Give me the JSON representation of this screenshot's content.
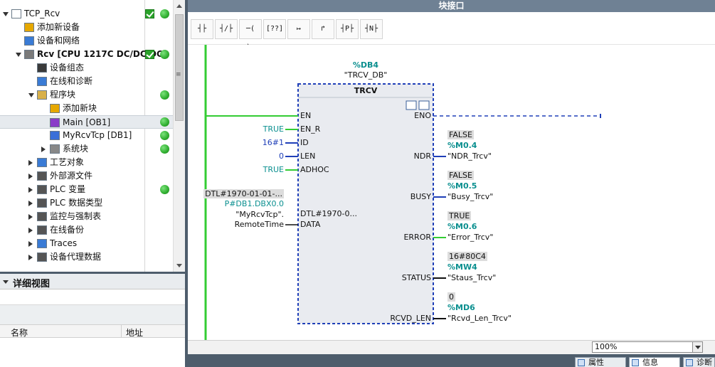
{
  "tree": {
    "items": [
      {
        "label": "TCP_Rcv",
        "indent": 0,
        "expand": "open",
        "icon": "project-icon",
        "check": true,
        "dot": true
      },
      {
        "label": "添加新设备",
        "indent": 1,
        "expand": "none",
        "icon": "add-device-icon"
      },
      {
        "label": "设备和网络",
        "indent": 1,
        "expand": "none",
        "icon": "network-icon"
      },
      {
        "label": "Rcv [CPU 1217C DC/DC/DC]",
        "indent": 1,
        "expand": "open",
        "icon": "cpu-icon",
        "check": true,
        "dot": true,
        "bold": true
      },
      {
        "label": "设备组态",
        "indent": 2,
        "expand": "none",
        "icon": "device-config-icon"
      },
      {
        "label": "在线和诊断",
        "indent": 2,
        "expand": "none",
        "icon": "diagnostics-icon"
      },
      {
        "label": "程序块",
        "indent": 2,
        "expand": "open",
        "icon": "folder-icon",
        "dot": true
      },
      {
        "label": "添加新块",
        "indent": 3,
        "expand": "none",
        "icon": "add-block-icon"
      },
      {
        "label": "Main [OB1]",
        "indent": 3,
        "expand": "none",
        "icon": "ob-block-icon",
        "dot": true,
        "selected": true
      },
      {
        "label": "MyRcvTcp [DB1]",
        "indent": 3,
        "expand": "none",
        "icon": "db-block-icon",
        "dot": true
      },
      {
        "label": "系统块",
        "indent": 3,
        "expand": "closed",
        "icon": "system-block-icon",
        "dot": true
      },
      {
        "label": "工艺对象",
        "indent": 2,
        "expand": "closed",
        "icon": "technology-object-icon"
      },
      {
        "label": "外部源文件",
        "indent": 2,
        "expand": "closed",
        "icon": "source-file-icon"
      },
      {
        "label": "PLC 变量",
        "indent": 2,
        "expand": "closed",
        "icon": "plc-tags-icon",
        "dot": true
      },
      {
        "label": "PLC 数据类型",
        "indent": 2,
        "expand": "closed",
        "icon": "data-type-icon"
      },
      {
        "label": "监控与强制表",
        "indent": 2,
        "expand": "closed",
        "icon": "watch-table-icon"
      },
      {
        "label": "在线备份",
        "indent": 2,
        "expand": "closed",
        "icon": "online-backup-icon"
      },
      {
        "label": "Traces",
        "indent": 2,
        "expand": "closed",
        "icon": "traces-icon"
      },
      {
        "label": "设备代理数据",
        "indent": 2,
        "expand": "closed",
        "icon": "proxy-data-icon"
      }
    ]
  },
  "detail_view": {
    "title": "详细视图",
    "col_name": "名称",
    "col_address": "地址"
  },
  "editor": {
    "title": "块接口",
    "toolbar": [
      {
        "name": "no-contact-button",
        "glyph": "┤├"
      },
      {
        "name": "nc-contact-button",
        "glyph": "┤/├"
      },
      {
        "name": "coil-button",
        "glyph": "─( )─"
      },
      {
        "name": "empty-box-button",
        "glyph": "[??]"
      },
      {
        "name": "open-branch-button",
        "glyph": "↦"
      },
      {
        "name": "close-branch-button",
        "glyph": "↱"
      },
      {
        "name": "p-contact-button",
        "glyph": "┤P├"
      },
      {
        "name": "n-contact-button",
        "glyph": "┤N├"
      }
    ],
    "zoom": "100%",
    "bottom_tabs": [
      "属性",
      "信息",
      "诊断"
    ]
  },
  "block": {
    "db_address": "%DB4",
    "db_name": "\"TRCV_DB\"",
    "type": "TRCV",
    "inputs": {
      "en": "EN",
      "en_r": "EN_R",
      "id": "ID",
      "len": "LEN",
      "adhoc": "ADHOC",
      "data": "DATA"
    },
    "input_values": {
      "en_r": "TRUE",
      "id": "16#1",
      "len": "0",
      "adhoc": "TRUE"
    },
    "data_param": {
      "value": "DTL#1970-01-01-...",
      "address": "P#DB1.DBX0.0",
      "symbol1": "\"MyRcvTcp\".",
      "symbol2": "RemoteTime",
      "inner_value": "DTL#1970-0..."
    },
    "outputs": [
      {
        "pin": "ENO"
      },
      {
        "pin": "NDR",
        "value": "FALSE",
        "address": "%M0.4",
        "symbol": "\"NDR_Trcv\""
      },
      {
        "pin": "BUSY",
        "value": "FALSE",
        "address": "%M0.5",
        "symbol": "\"Busy_Trcv\""
      },
      {
        "pin": "ERROR",
        "value": "TRUE",
        "address": "%M0.6",
        "symbol": "\"Error_Trcv\""
      },
      {
        "pin": "STATUS",
        "value": "16#80C4",
        "address": "%MW4",
        "symbol": "\"Staus_Trcv\""
      },
      {
        "pin": "RCVD_LEN",
        "value": "0",
        "address": "%MD6",
        "symbol": "\"Rcvd_Len_Trcv\""
      }
    ]
  },
  "colors": {
    "accent_teal": "#0a8f8f",
    "wire_green": "#33cc33",
    "wire_blue": "#1f3fb8",
    "block_border": "#1f3fb8",
    "block_fill": "#e9ebf0",
    "title_bar": "#6f8194",
    "splitter": "#4e5d6c"
  }
}
